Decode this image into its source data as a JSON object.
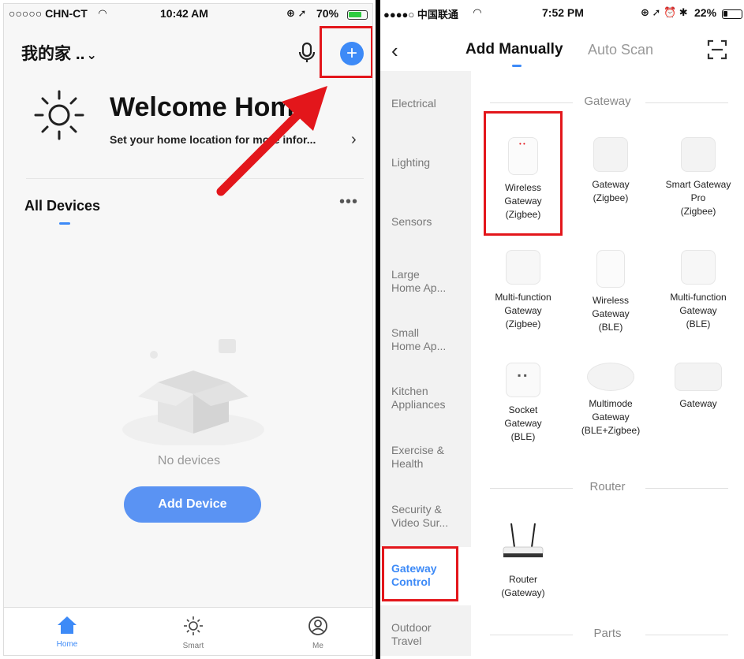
{
  "left": {
    "status": {
      "carrier": "○○○○○ CHN-CT",
      "time": "10:42 AM",
      "battery": "70%"
    },
    "home_name": "我的家 ..",
    "welcome_title": "Welcome Home",
    "welcome_sub": "Set your home location for more infor...",
    "all_devices": "All Devices",
    "more": "•••",
    "no_devices": "No devices",
    "add_device": "Add Device",
    "tabs": [
      {
        "label": "Home",
        "icon": "home-icon"
      },
      {
        "label": "Smart",
        "icon": "sun-icon"
      },
      {
        "label": "Me",
        "icon": "profile-icon"
      }
    ]
  },
  "right": {
    "status": {
      "carrier": "●●●●○ 中国联通",
      "time": "7:52 PM",
      "battery": "22%"
    },
    "tab_manual": "Add Manually",
    "tab_auto": "Auto Scan",
    "categories": [
      "Electrical",
      "Lighting",
      "Sensors",
      "Large\nHome Ap...",
      "Small\nHome Ap...",
      "Kitchen\nAppliances",
      "Exercise &\nHealth",
      "Security &\nVideo Sur...",
      "Gateway\nControl",
      "Outdoor\nTravel"
    ],
    "selected_category": "Gateway\nControl",
    "sections": {
      "gateway": "Gateway",
      "router": "Router",
      "parts": "Parts"
    },
    "devices": [
      "Wireless\nGateway\n(Zigbee)",
      "Gateway\n(Zigbee)",
      "Smart Gateway\nPro\n(Zigbee)",
      "Multi-function\nGateway\n(Zigbee)",
      "Wireless\nGateway\n(BLE)",
      "Multi-function\nGateway\n(BLE)",
      "Socket\nGateway\n(BLE)",
      "Multimode\nGateway\n(BLE+Zigbee)",
      "Gateway",
      "Router\n(Gateway)"
    ]
  },
  "colors": {
    "accent": "#3d8af7",
    "highlight": "#e3161b"
  }
}
